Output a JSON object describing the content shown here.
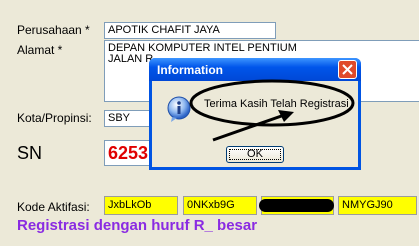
{
  "form": {
    "company_label": "Perusahaan *",
    "company_value": "APOTIK CHAFIT JAYA",
    "address_label": "Alamat *",
    "address_line1": "DEPAN KOMPUTER INTEL PENTIUM",
    "address_line2": "JALAN R",
    "city_label": "Kota/Propinsi:",
    "city_value": "SBY",
    "sn_label": "SN",
    "sn_value": "6253",
    "activation_label": "Kode Aktifasi:",
    "codes": [
      "JxbLkOb",
      "0NKxb9G",
      "",
      "NMYGJ90"
    ],
    "note": "Registrasi dengan huruf R_ besar"
  },
  "dialog": {
    "title": "Information",
    "message": "Terima Kasih Telah Registrasi",
    "ok_label": "OK",
    "icon": "info-icon"
  },
  "colors": {
    "sn": "#e00000",
    "code_bg": "#ffff00",
    "note": "#8a2be2",
    "titlebar": "#0055ea"
  }
}
